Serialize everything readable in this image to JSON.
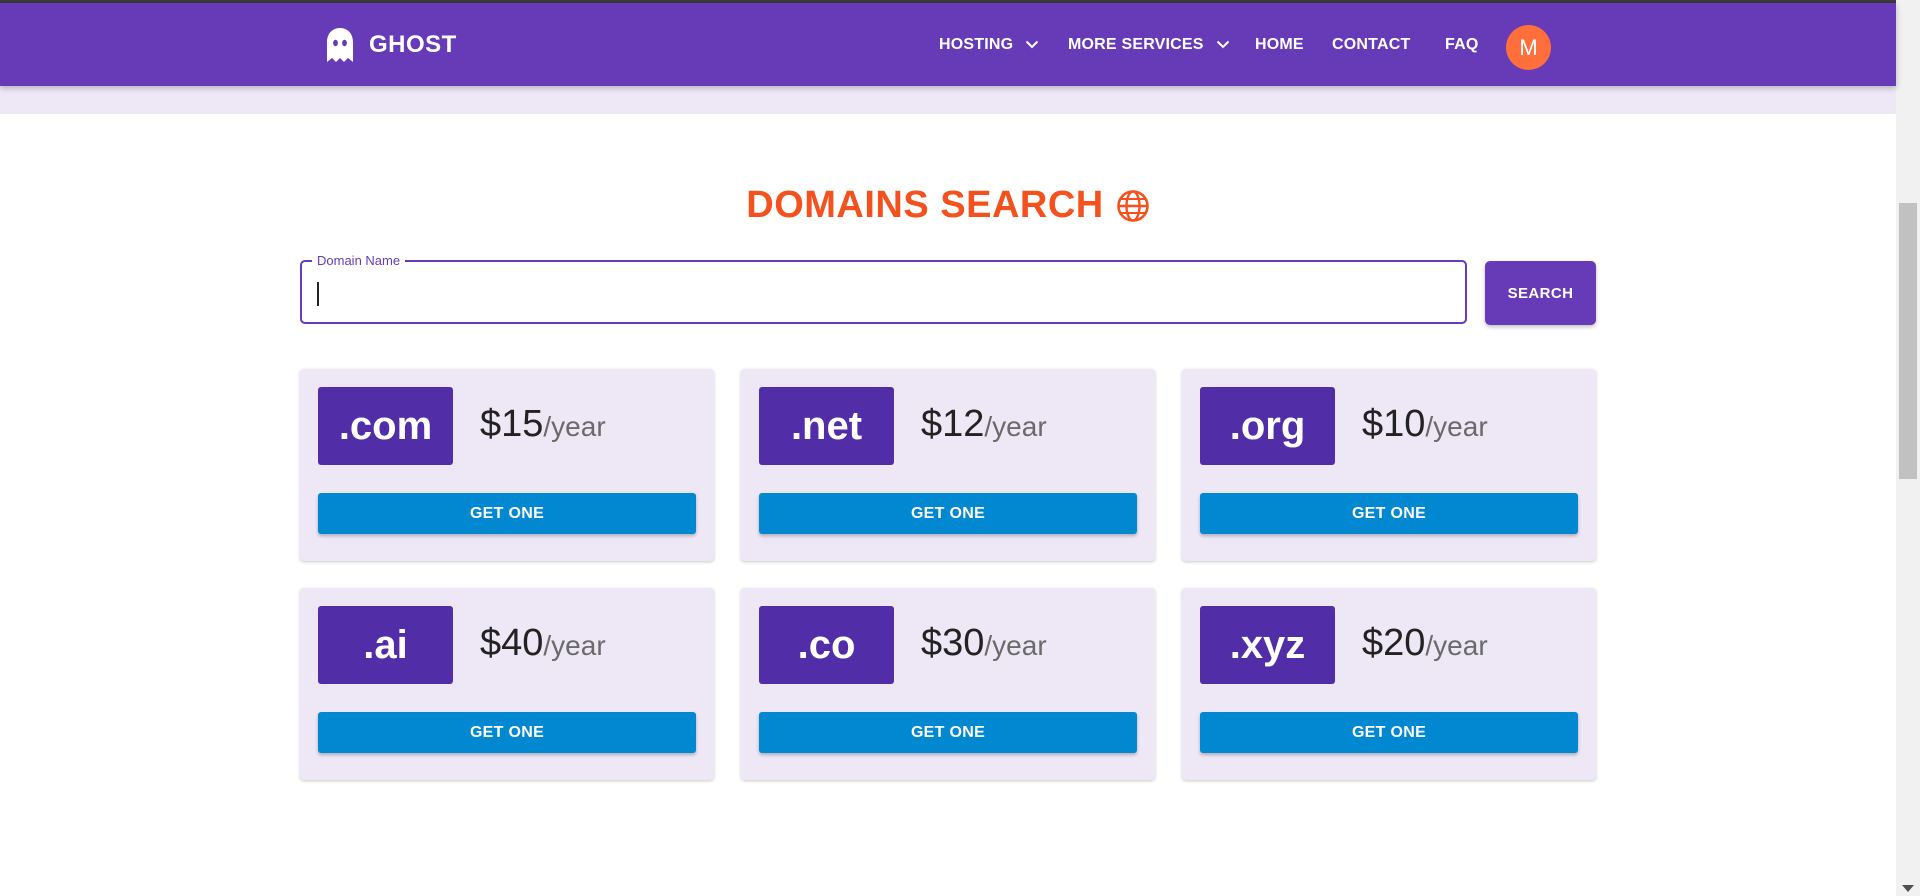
{
  "header": {
    "brand": "GHOST",
    "nav": [
      {
        "label": "HOSTING",
        "has_dropdown": true
      },
      {
        "label": "MORE SERVICES",
        "has_dropdown": true
      },
      {
        "label": "HOME",
        "has_dropdown": false
      },
      {
        "label": "CONTACT",
        "has_dropdown": false
      },
      {
        "label": "FAQ",
        "has_dropdown": false
      }
    ],
    "avatar_initial": "M",
    "colors": {
      "bar": "#673ab7",
      "avatar": "#ff6f3c"
    }
  },
  "search": {
    "title": "DOMAINS SEARCH",
    "title_icon": "globe-icon",
    "field_label": "Domain Name",
    "field_value": "",
    "button_label": "SEARCH"
  },
  "domains": [
    {
      "tld": ".com",
      "price": "$15",
      "period": "/year",
      "button_label": "GET ONE"
    },
    {
      "tld": ".net",
      "price": "$12",
      "period": "/year",
      "button_label": "GET ONE"
    },
    {
      "tld": ".org",
      "price": "$10",
      "period": "/year",
      "button_label": "GET ONE"
    },
    {
      "tld": ".ai",
      "price": "$40",
      "period": "/year",
      "button_label": "GET ONE"
    },
    {
      "tld": ".co",
      "price": "$30",
      "period": "/year",
      "button_label": "GET ONE"
    },
    {
      "tld": ".xyz",
      "price": "$20",
      "period": "/year",
      "button_label": "GET ONE"
    }
  ],
  "colors": {
    "title": "#f4511e",
    "tld_box": "#512da8",
    "get_button": "#0288d1",
    "card": "#ede7f6"
  }
}
